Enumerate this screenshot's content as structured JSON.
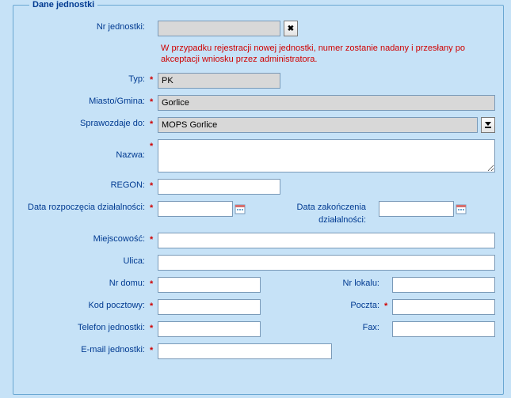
{
  "panel": {
    "legend": "Dane jednostki"
  },
  "labels": {
    "unit_no": "Nr jednostki:",
    "type": "Typ:",
    "city_gmina": "Miasto/Gmina:",
    "reports_to": "Sprawozdaje do:",
    "name": "Nazwa:",
    "regon": "REGON:",
    "start_date": "Data rozpoczęcia działalności:",
    "end_date": "Data zakończenia działalności:",
    "locality": "Miejscowość:",
    "street": "Ulica:",
    "house_no": "Nr domu:",
    "apt_no": "Nr lokalu:",
    "postal": "Kod pocztowy:",
    "post": "Poczta:",
    "phone": "Telefon jednostki:",
    "fax": "Fax:",
    "email": "E-mail jednostki:"
  },
  "values": {
    "unit_no": "",
    "type": "PK",
    "city_gmina": "Gorlice",
    "reports_to": "MOPS Gorlice",
    "name": "",
    "regon": "",
    "start_date": "",
    "end_date": "",
    "locality": "",
    "street": "",
    "house_no": "",
    "apt_no": "",
    "postal": "",
    "post": "",
    "phone": "",
    "fax": "",
    "email": ""
  },
  "note": "W przypadku rejestracji nowej jednostki, numer zostanie nadany i przesłany po akceptacji wniosku przez administratora.",
  "req_marker": "*"
}
